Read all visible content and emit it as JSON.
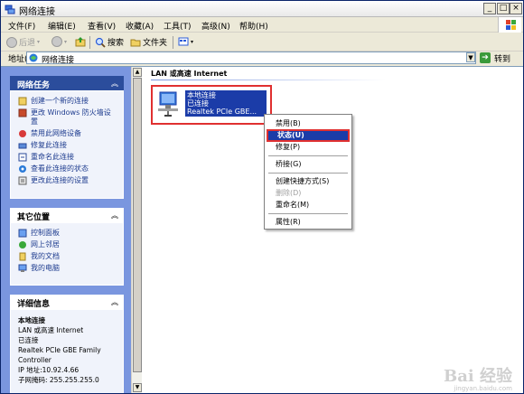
{
  "window": {
    "title": "网络连接",
    "minimize": "_",
    "maximize": "□",
    "close": "×"
  },
  "menu": [
    {
      "label": "文件(F)"
    },
    {
      "label": "编辑(E)"
    },
    {
      "label": "查看(V)"
    },
    {
      "label": "收藏(A)"
    },
    {
      "label": "工具(T)"
    },
    {
      "label": "高级(N)"
    },
    {
      "label": "帮助(H)"
    }
  ],
  "toolbar": {
    "back": "后退",
    "search": "搜索",
    "folders": "文件夹"
  },
  "address": {
    "label": "地址(D)",
    "value": "网络连接",
    "go": "转到"
  },
  "left_pane": {
    "network_tasks": {
      "title": "网络任务",
      "items": [
        {
          "label": "创建一个新的连接"
        },
        {
          "label": "更改 Windows 防火墙设置"
        },
        {
          "label": "禁用此网络设备"
        },
        {
          "label": "修复此连接"
        },
        {
          "label": "重命名此连接"
        },
        {
          "label": "查看此连接的状态"
        },
        {
          "label": "更改此连接的设置"
        }
      ]
    },
    "other_places": {
      "title": "其它位置",
      "items": [
        {
          "label": "控制面板"
        },
        {
          "label": "网上邻居"
        },
        {
          "label": "我的文档"
        },
        {
          "label": "我的电脑"
        }
      ]
    },
    "details": {
      "title": "详细信息",
      "name": "本地连接",
      "line1": "LAN 或高速 Internet",
      "line2": "已连接",
      "line3": "Realtek PCIe GBE Family Controller",
      "line4": "IP 地址:10.92.4.66",
      "line5": "子网掩码: 255.255.255.0"
    }
  },
  "main": {
    "section": "LAN 或高速 Internet",
    "connection": {
      "name": "本地连接",
      "status": "已连接",
      "device": "Realtek PCIe GBE..."
    }
  },
  "context_menu": {
    "items": [
      {
        "label": "禁用(B)"
      },
      {
        "label": "状态(U)"
      },
      {
        "label": "修复(P)"
      },
      {
        "label": "桥接(G)"
      },
      {
        "label": "创建快捷方式(S)"
      },
      {
        "label": "删除(D)"
      },
      {
        "label": "重命名(M)"
      },
      {
        "label": "属性(R)"
      }
    ]
  },
  "watermark": {
    "text": "Bai 经验",
    "sub": "jingyan.baidu.com"
  }
}
